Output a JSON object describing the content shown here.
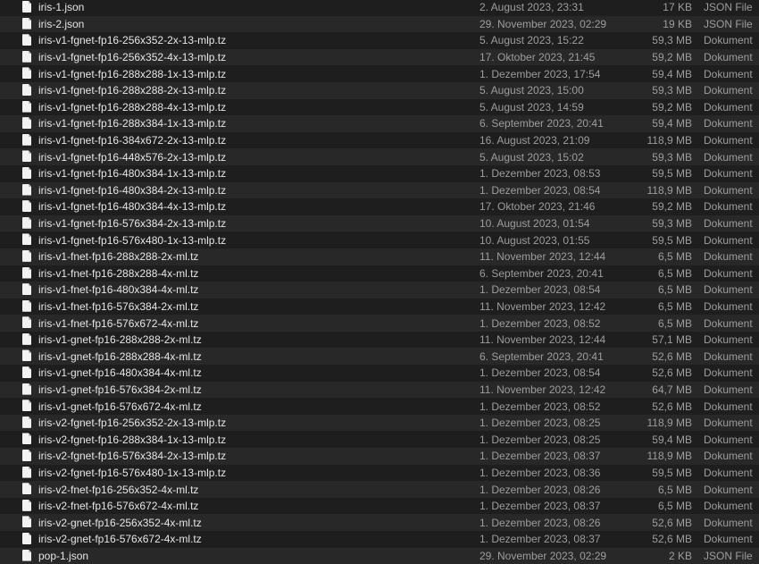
{
  "files": [
    {
      "name": "iris-1.json",
      "date": "2. August 2023, 23:31",
      "size": "17 KB",
      "kind": "JSON File",
      "icon": "document-icon"
    },
    {
      "name": "iris-2.json",
      "date": "29. November 2023, 02:29",
      "size": "19 KB",
      "kind": "JSON File",
      "icon": "document-icon"
    },
    {
      "name": "iris-v1-fgnet-fp16-256x352-2x-13-mlp.tz",
      "date": "5. August 2023, 15:22",
      "size": "59,3 MB",
      "kind": "Dokument",
      "icon": "document-icon"
    },
    {
      "name": "iris-v1-fgnet-fp16-256x352-4x-13-mlp.tz",
      "date": "17. Oktober 2023, 21:45",
      "size": "59,2 MB",
      "kind": "Dokument",
      "icon": "document-icon"
    },
    {
      "name": "iris-v1-fgnet-fp16-288x288-1x-13-mlp.tz",
      "date": "1. Dezember 2023, 17:54",
      "size": "59,4 MB",
      "kind": "Dokument",
      "icon": "document-icon"
    },
    {
      "name": "iris-v1-fgnet-fp16-288x288-2x-13-mlp.tz",
      "date": "5. August 2023, 15:00",
      "size": "59,3 MB",
      "kind": "Dokument",
      "icon": "document-icon"
    },
    {
      "name": "iris-v1-fgnet-fp16-288x288-4x-13-mlp.tz",
      "date": "5. August 2023, 14:59",
      "size": "59,2 MB",
      "kind": "Dokument",
      "icon": "document-icon"
    },
    {
      "name": "iris-v1-fgnet-fp16-288x384-1x-13-mlp.tz",
      "date": "6. September 2023, 20:41",
      "size": "59,4 MB",
      "kind": "Dokument",
      "icon": "document-icon"
    },
    {
      "name": "iris-v1-fgnet-fp16-384x672-2x-13-mlp.tz",
      "date": "16. August 2023, 21:09",
      "size": "118,9 MB",
      "kind": "Dokument",
      "icon": "document-icon"
    },
    {
      "name": "iris-v1-fgnet-fp16-448x576-2x-13-mlp.tz",
      "date": "5. August 2023, 15:02",
      "size": "59,3 MB",
      "kind": "Dokument",
      "icon": "document-icon"
    },
    {
      "name": "iris-v1-fgnet-fp16-480x384-1x-13-mlp.tz",
      "date": "1. Dezember 2023, 08:53",
      "size": "59,5 MB",
      "kind": "Dokument",
      "icon": "document-icon"
    },
    {
      "name": "iris-v1-fgnet-fp16-480x384-2x-13-mlp.tz",
      "date": "1. Dezember 2023, 08:54",
      "size": "118,9 MB",
      "kind": "Dokument",
      "icon": "document-icon"
    },
    {
      "name": "iris-v1-fgnet-fp16-480x384-4x-13-mlp.tz",
      "date": "17. Oktober 2023, 21:46",
      "size": "59,2 MB",
      "kind": "Dokument",
      "icon": "document-icon"
    },
    {
      "name": "iris-v1-fgnet-fp16-576x384-2x-13-mlp.tz",
      "date": "10. August 2023, 01:54",
      "size": "59,3 MB",
      "kind": "Dokument",
      "icon": "document-icon"
    },
    {
      "name": "iris-v1-fgnet-fp16-576x480-1x-13-mlp.tz",
      "date": "10. August 2023, 01:55",
      "size": "59,5 MB",
      "kind": "Dokument",
      "icon": "document-icon"
    },
    {
      "name": "iris-v1-fnet-fp16-288x288-2x-ml.tz",
      "date": "11. November 2023, 12:44",
      "size": "6,5 MB",
      "kind": "Dokument",
      "icon": "document-icon"
    },
    {
      "name": "iris-v1-fnet-fp16-288x288-4x-ml.tz",
      "date": "6. September 2023, 20:41",
      "size": "6,5 MB",
      "kind": "Dokument",
      "icon": "document-icon"
    },
    {
      "name": "iris-v1-fnet-fp16-480x384-4x-ml.tz",
      "date": "1. Dezember 2023, 08:54",
      "size": "6,5 MB",
      "kind": "Dokument",
      "icon": "document-icon"
    },
    {
      "name": "iris-v1-fnet-fp16-576x384-2x-ml.tz",
      "date": "11. November 2023, 12:42",
      "size": "6,5 MB",
      "kind": "Dokument",
      "icon": "document-icon"
    },
    {
      "name": "iris-v1-fnet-fp16-576x672-4x-ml.tz",
      "date": "1. Dezember 2023, 08:52",
      "size": "6,5 MB",
      "kind": "Dokument",
      "icon": "document-icon"
    },
    {
      "name": "iris-v1-gnet-fp16-288x288-2x-ml.tz",
      "date": "11. November 2023, 12:44",
      "size": "57,1 MB",
      "kind": "Dokument",
      "icon": "document-icon"
    },
    {
      "name": "iris-v1-gnet-fp16-288x288-4x-ml.tz",
      "date": "6. September 2023, 20:41",
      "size": "52,6 MB",
      "kind": "Dokument",
      "icon": "document-icon"
    },
    {
      "name": "iris-v1-gnet-fp16-480x384-4x-ml.tz",
      "date": "1. Dezember 2023, 08:54",
      "size": "52,6 MB",
      "kind": "Dokument",
      "icon": "document-icon"
    },
    {
      "name": "iris-v1-gnet-fp16-576x384-2x-ml.tz",
      "date": "11. November 2023, 12:42",
      "size": "64,7 MB",
      "kind": "Dokument",
      "icon": "document-icon"
    },
    {
      "name": "iris-v1-gnet-fp16-576x672-4x-ml.tz",
      "date": "1. Dezember 2023, 08:52",
      "size": "52,6 MB",
      "kind": "Dokument",
      "icon": "document-icon"
    },
    {
      "name": "iris-v2-fgnet-fp16-256x352-2x-13-mlp.tz",
      "date": "1. Dezember 2023, 08:25",
      "size": "118,9 MB",
      "kind": "Dokument",
      "icon": "document-icon"
    },
    {
      "name": "iris-v2-fgnet-fp16-288x384-1x-13-mlp.tz",
      "date": "1. Dezember 2023, 08:25",
      "size": "59,4 MB",
      "kind": "Dokument",
      "icon": "document-icon"
    },
    {
      "name": "iris-v2-fgnet-fp16-576x384-2x-13-mlp.tz",
      "date": "1. Dezember 2023, 08:37",
      "size": "118,9 MB",
      "kind": "Dokument",
      "icon": "document-icon"
    },
    {
      "name": "iris-v2-fgnet-fp16-576x480-1x-13-mlp.tz",
      "date": "1. Dezember 2023, 08:36",
      "size": "59,5 MB",
      "kind": "Dokument",
      "icon": "document-icon"
    },
    {
      "name": "iris-v2-fnet-fp16-256x352-4x-ml.tz",
      "date": "1. Dezember 2023, 08:26",
      "size": "6,5 MB",
      "kind": "Dokument",
      "icon": "document-icon"
    },
    {
      "name": "iris-v2-fnet-fp16-576x672-4x-ml.tz",
      "date": "1. Dezember 2023, 08:37",
      "size": "6,5 MB",
      "kind": "Dokument",
      "icon": "document-icon"
    },
    {
      "name": "iris-v2-gnet-fp16-256x352-4x-ml.tz",
      "date": "1. Dezember 2023, 08:26",
      "size": "52,6 MB",
      "kind": "Dokument",
      "icon": "document-icon"
    },
    {
      "name": "iris-v2-gnet-fp16-576x672-4x-ml.tz",
      "date": "1. Dezember 2023, 08:37",
      "size": "52,6 MB",
      "kind": "Dokument",
      "icon": "document-icon"
    },
    {
      "name": "pop-1.json",
      "date": "29. November 2023, 02:29",
      "size": "2 KB",
      "kind": "JSON File",
      "icon": "document-icon"
    }
  ]
}
